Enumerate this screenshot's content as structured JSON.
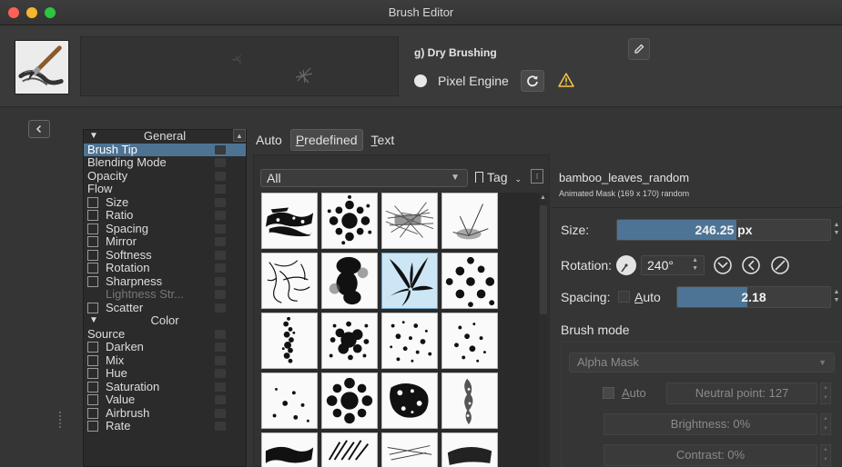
{
  "window": {
    "title": "Brush Editor"
  },
  "header": {
    "preset_name": "g) Dry Brushing",
    "engine_label": "Pixel Engine"
  },
  "options": {
    "items": [
      {
        "label": "General",
        "type": "group"
      },
      {
        "label": "Brush Tip",
        "type": "plain",
        "selected": true
      },
      {
        "label": "Blending Mode",
        "type": "plain"
      },
      {
        "label": "Opacity",
        "type": "plain"
      },
      {
        "label": "Flow",
        "type": "plain"
      },
      {
        "label": "Size",
        "type": "check"
      },
      {
        "label": "Ratio",
        "type": "check"
      },
      {
        "label": "Spacing",
        "type": "check"
      },
      {
        "label": "Mirror",
        "type": "check"
      },
      {
        "label": "Softness",
        "type": "check"
      },
      {
        "label": "Rotation",
        "type": "check"
      },
      {
        "label": "Sharpness",
        "type": "check"
      },
      {
        "label": "Lightness Str...",
        "type": "dim"
      },
      {
        "label": "Scatter",
        "type": "check"
      },
      {
        "label": "Color",
        "type": "group"
      },
      {
        "label": "Source",
        "type": "plain"
      },
      {
        "label": "Darken",
        "type": "check"
      },
      {
        "label": "Mix",
        "type": "check"
      },
      {
        "label": "Hue",
        "type": "check"
      },
      {
        "label": "Saturation",
        "type": "check"
      },
      {
        "label": "Value",
        "type": "check"
      },
      {
        "label": "Airbrush",
        "type": "check"
      },
      {
        "label": "Rate",
        "type": "check"
      }
    ]
  },
  "tabs": {
    "auto": "Auto",
    "predefined_prefix": "P",
    "predefined_rest": "redefined",
    "text_prefix": "T",
    "text_rest": "ext"
  },
  "chooser": {
    "filter": "All",
    "tag_label": "Tag"
  },
  "brush_info": {
    "name": "bamboo_leaves_random",
    "description": "Animated Mask (169 x 170) random"
  },
  "controls": {
    "size_label": "Size:",
    "size_value": "246.25 px",
    "size_fraction": 0.56,
    "rotation_label": "Rotation:",
    "rotation_value": "240°",
    "spacing_label": "Spacing:",
    "spacing_auto_prefix": "A",
    "spacing_auto_rest": "uto",
    "spacing_value": "2.18",
    "spacing_fraction": 0.46
  },
  "brush_mode": {
    "label": "Brush mode",
    "mode": "Alpha Mask",
    "auto_prefix": "A",
    "auto_rest": "uto",
    "neutral_point": "Neutral point: 127",
    "brightness": "Brightness: 0%",
    "contrast": "Contrast: 0%"
  },
  "colors": {
    "accent": "#4d7494",
    "selection": "#4d7392",
    "warning": "#f5c542"
  }
}
